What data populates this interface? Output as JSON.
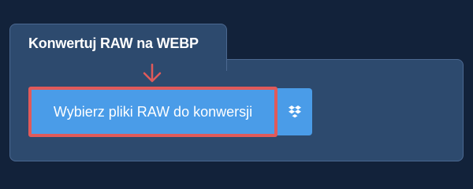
{
  "converter": {
    "title": "Konwertuj RAW na WEBP",
    "upload_button_label": "Wybierz pliki RAW do konwersji",
    "dropbox_icon": "dropbox-icon",
    "arrow_icon": "arrow-down-icon"
  },
  "colors": {
    "page_background": "#12223a",
    "panel_background": "#2d4a6e",
    "button_blue": "#4a9ce8",
    "highlight_red": "#e05a5a"
  }
}
